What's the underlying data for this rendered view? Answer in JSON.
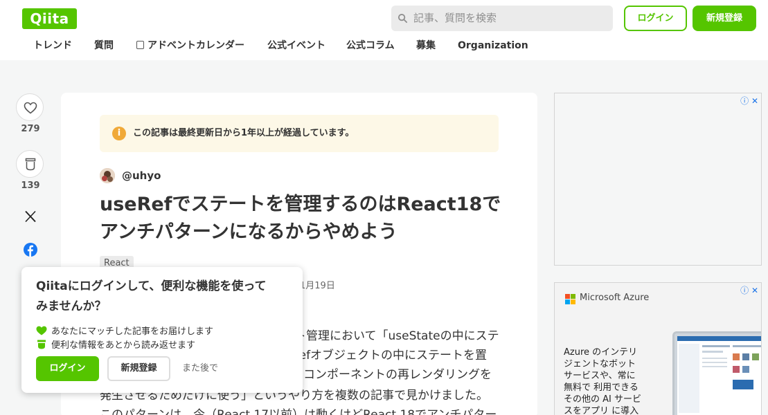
{
  "header": {
    "logo": "Qiita",
    "search_placeholder": "記事、質問を検索",
    "login_label": "ログイン",
    "signup_label": "新規登録"
  },
  "nav": {
    "items": [
      "トレンド",
      "質問",
      "アドベントカレンダー",
      "公式イベント",
      "公式コラム",
      "募集",
      "Organization"
    ]
  },
  "actions": {
    "like_count": "279",
    "stock_count": "139"
  },
  "article": {
    "notice": "この記事は最終更新日から1年以上が経過しています。",
    "author": "@uhyo",
    "title_line1": "useRefでステートを管理するのはReact18で",
    "title_line2": "アンチパターンになるからやめよう",
    "tag": "React",
    "date_fragment": "1月19日",
    "body": [
      "ト管理において「useStateの中にステ",
      "refオブジェクトの中にステートを置",
      "コンポーネントの再レンダリングを",
      "発生させるためだけに使う」というやり方を複数の記事で見かけました。",
      "このパターンは、今（React 17以前）は動くけどReact 18でアンチパター"
    ]
  },
  "ads": {
    "adchoices_icon": "ⓘ",
    "close_icon": "✕",
    "brand": "Microsoft Azure",
    "copy_lines": [
      "Azure のインテリ",
      "ジェントなボット",
      "サービスや、常に",
      "無料で 利用できる",
      "その他の AI サービ",
      "スをアプリ に導入"
    ]
  },
  "popup": {
    "heading_line1": "Qiitaにログインして、便利な機能を使って",
    "heading_line2": "みませんか？",
    "features": [
      "あなたにマッチした記事をお届けします",
      "便利な情報をあとから読み返せます"
    ],
    "login_label": "ログイン",
    "signup_label": "新規登録",
    "later_label": "また後で"
  },
  "colors": {
    "brand_green": "#55c500",
    "notice_bg": "#fdf8e7",
    "notice_icon": "#f0a938",
    "facebook_blue": "#1877f2"
  }
}
